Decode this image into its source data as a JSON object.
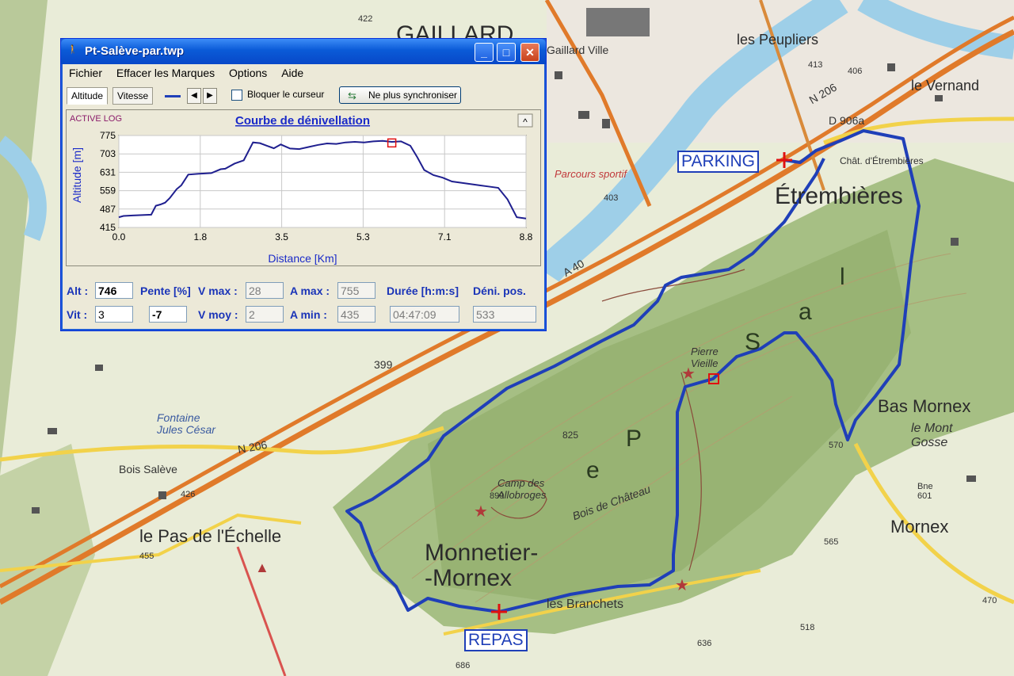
{
  "map": {
    "labels": {
      "gaillard": "GAILLARD",
      "gaillard_ville": "Gaillard Ville",
      "peupliers": "les Peupliers",
      "le_vernand": "le Vernand",
      "etrembieres": "Étrembières",
      "chat_etrembieres": "Chât. d'Étrembières",
      "parcours_sportif": "Parcours sportif",
      "d906a": "D 906a",
      "n206_top": "N 206",
      "n206_left": "N 206",
      "a40": "A 40",
      "bois_saleve": "Bois Salève",
      "fontaine": "Fontaine Jules César",
      "pas_echelle": "le Pas de l'Échelle",
      "monnetier": "Monnetier-",
      "mornex_line": "-Mornex",
      "bas_mornex": "Bas Mornex",
      "le_mont_gosse": "le Mont Gosse",
      "mornex": "Mornex",
      "pierre_vieille": "Pierre Vieille",
      "camp_allobroges": "Camp des Allobroges",
      "bois_chateau": "Bois de Château",
      "les_branchets": "les Branchets",
      "saleve_letter1": "S",
      "saleve_letter2": "a",
      "saleve_letter3": "l",
      "saleve_letter4": "e",
      "saleve_letter5": "P",
      "alt_399": "399",
      "alt_825": "825",
      "alt_899": "899",
      "alt_570": "570",
      "alt_565": "565",
      "alt_636": "636",
      "alt_686": "686",
      "alt_422": "422",
      "alt_455": "455",
      "alt_426": "426",
      "alt_403": "403",
      "alt_413": "413",
      "alt_406": "406",
      "alt_518": "518",
      "alt_470": "470",
      "alt_601": "Bne 601"
    },
    "tags": {
      "parking": "PARKING",
      "repas": "REPAS"
    }
  },
  "window": {
    "title": "Pt-Salève-par.twp",
    "icon": "hiker-icon",
    "controls": {
      "minimize": "_",
      "maximize": "□",
      "close": "✕"
    },
    "menu": [
      "Fichier",
      "Effacer les Marques",
      "Options",
      "Aide"
    ],
    "toolbar": {
      "tab_altitude": "Altitude",
      "tab_vitesse": "Vitesse",
      "prev": "◀",
      "next": "▶",
      "lock_cursor_label": "Bloquer le curseur",
      "lock_cursor_checked": false,
      "sync_button": "Ne plus synchroniser"
    },
    "chart_header": {
      "active_log": "ACTIVE LOG",
      "collapse": "^"
    }
  },
  "chart_data": {
    "type": "line",
    "title": "Courbe de dénivellation",
    "xlabel": "Distance [Km]",
    "ylabel": "Altitude [m]",
    "xlim": [
      0,
      8.8
    ],
    "ylim": [
      415,
      775
    ],
    "x_ticks": [
      "0.0",
      "1.8",
      "3.5",
      "5.3",
      "7.1",
      "8.8"
    ],
    "y_ticks": [
      "775",
      "703",
      "631",
      "559",
      "487",
      "415"
    ],
    "grid": true,
    "color": "#1f1f8f",
    "cursor_marker": {
      "x": 5.9,
      "y": 746
    },
    "series": [
      {
        "x": [
          0.0,
          0.1,
          0.3,
          0.7,
          0.8,
          0.9,
          1.0,
          1.1,
          1.25,
          1.35,
          1.5,
          1.7,
          2.0,
          2.2,
          2.3,
          2.5,
          2.7,
          2.9,
          3.05,
          3.2,
          3.35,
          3.5,
          3.7,
          3.9,
          4.1,
          4.3,
          4.5,
          4.7,
          4.9,
          5.1,
          5.3,
          5.5,
          5.7,
          5.9,
          6.1,
          6.3,
          6.45,
          6.6,
          6.8,
          7.0,
          7.2,
          7.4,
          7.6,
          7.8,
          8.0,
          8.2,
          8.4,
          8.6,
          8.8
        ],
        "y": [
          455,
          460,
          462,
          465,
          500,
          505,
          512,
          530,
          565,
          580,
          622,
          625,
          628,
          643,
          645,
          665,
          678,
          748,
          745,
          735,
          725,
          740,
          724,
          722,
          730,
          738,
          744,
          742,
          748,
          750,
          748,
          752,
          754,
          750,
          752,
          735,
          690,
          640,
          620,
          610,
          595,
          590,
          585,
          580,
          575,
          570,
          525,
          455,
          450
        ]
      }
    ]
  },
  "readouts": {
    "alt_label": "Alt :",
    "alt_value": "746",
    "vit_label": "Vit :",
    "vit_value": "3",
    "pente_label": "Pente [%]",
    "pente_value": "-7",
    "vmax_label": "V max :",
    "vmax_value": "28",
    "vmoy_label": "V moy :",
    "vmoy_value": "2",
    "amax_label": "A max :",
    "amax_value": "755",
    "amin_label": "A min :",
    "amin_value": "435",
    "duree_label": "Durée [h:m:s]",
    "duree_value": "04:47:09",
    "deni_label": "Déni. pos.",
    "deni_value": "533"
  },
  "colors": {
    "track": "#1f3fb8",
    "titlebar": "#0a5ad7",
    "forest": "#9cb87a",
    "river": "#9ecfe8",
    "road_main": "#e07a2a",
    "road_secondary": "#f2d24a"
  }
}
